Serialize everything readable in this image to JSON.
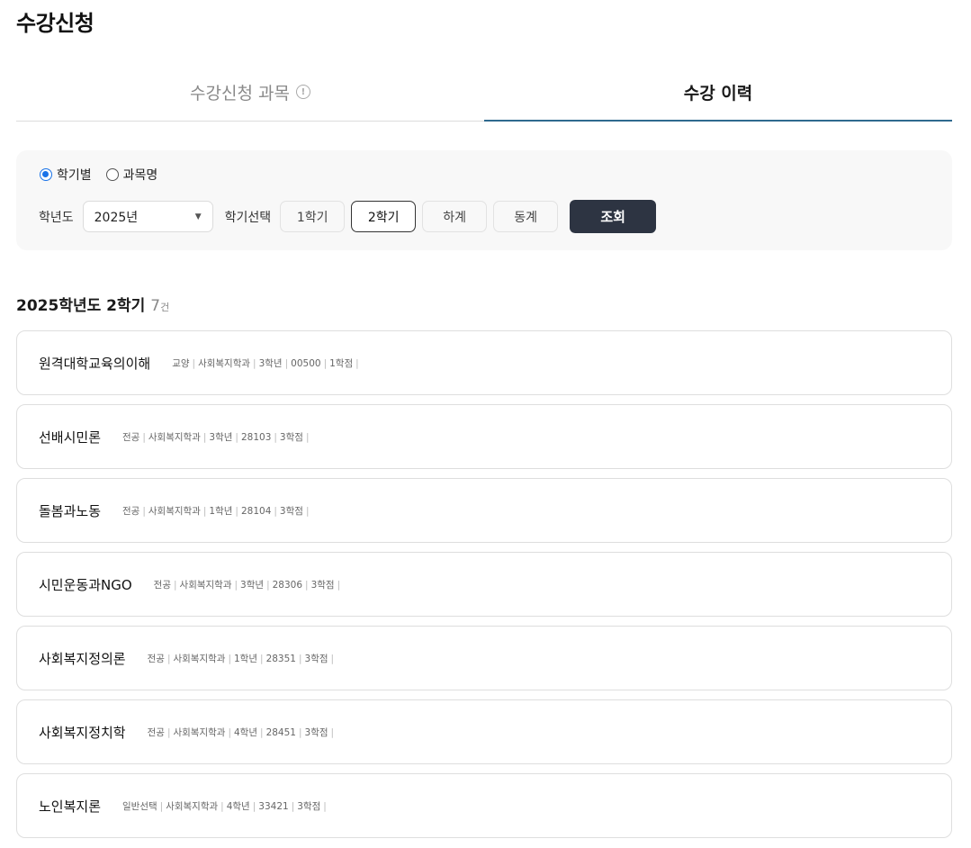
{
  "page": {
    "title": "수강신청"
  },
  "tabs": [
    {
      "label": "수강신청 과목",
      "active": false,
      "icon": "info-icon"
    },
    {
      "label": "수강 이력",
      "active": true
    }
  ],
  "filter": {
    "radios": [
      {
        "label": "학기별",
        "checked": true
      },
      {
        "label": "과목명",
        "checked": false
      }
    ],
    "year_label": "학년도",
    "year_value": "2025년",
    "semester_label": "학기선택",
    "semesters": [
      {
        "label": "1학기",
        "selected": false
      },
      {
        "label": "2학기",
        "selected": true
      },
      {
        "label": "하계",
        "selected": false
      },
      {
        "label": "동계",
        "selected": false
      }
    ],
    "search_label": "조회"
  },
  "results": {
    "title": "2025학년도 2학기",
    "count": "7",
    "count_unit": "건",
    "courses": [
      {
        "name": "원격대학교육의이해",
        "type": "교양",
        "dept": "사회복지학과",
        "grade": "3학년",
        "code": "00500",
        "credit": "1학점"
      },
      {
        "name": "선배시민론",
        "type": "전공",
        "dept": "사회복지학과",
        "grade": "3학년",
        "code": "28103",
        "credit": "3학점"
      },
      {
        "name": "돌봄과노동",
        "type": "전공",
        "dept": "사회복지학과",
        "grade": "1학년",
        "code": "28104",
        "credit": "3학점"
      },
      {
        "name": "시민운동과NGO",
        "type": "전공",
        "dept": "사회복지학과",
        "grade": "3학년",
        "code": "28306",
        "credit": "3학점"
      },
      {
        "name": "사회복지정의론",
        "type": "전공",
        "dept": "사회복지학과",
        "grade": "1학년",
        "code": "28351",
        "credit": "3학점"
      },
      {
        "name": "사회복지정치학",
        "type": "전공",
        "dept": "사회복지학과",
        "grade": "4학년",
        "code": "28451",
        "credit": "3학점"
      },
      {
        "name": "노인복지론",
        "type": "일반선택",
        "dept": "사회복지학과",
        "grade": "4학년",
        "code": "33421",
        "credit": "3학점"
      }
    ]
  },
  "colors": {
    "primary_button": "#2d3442",
    "active_tab_underline": "#2f6a8e",
    "radio_checked": "#1a73e8"
  }
}
